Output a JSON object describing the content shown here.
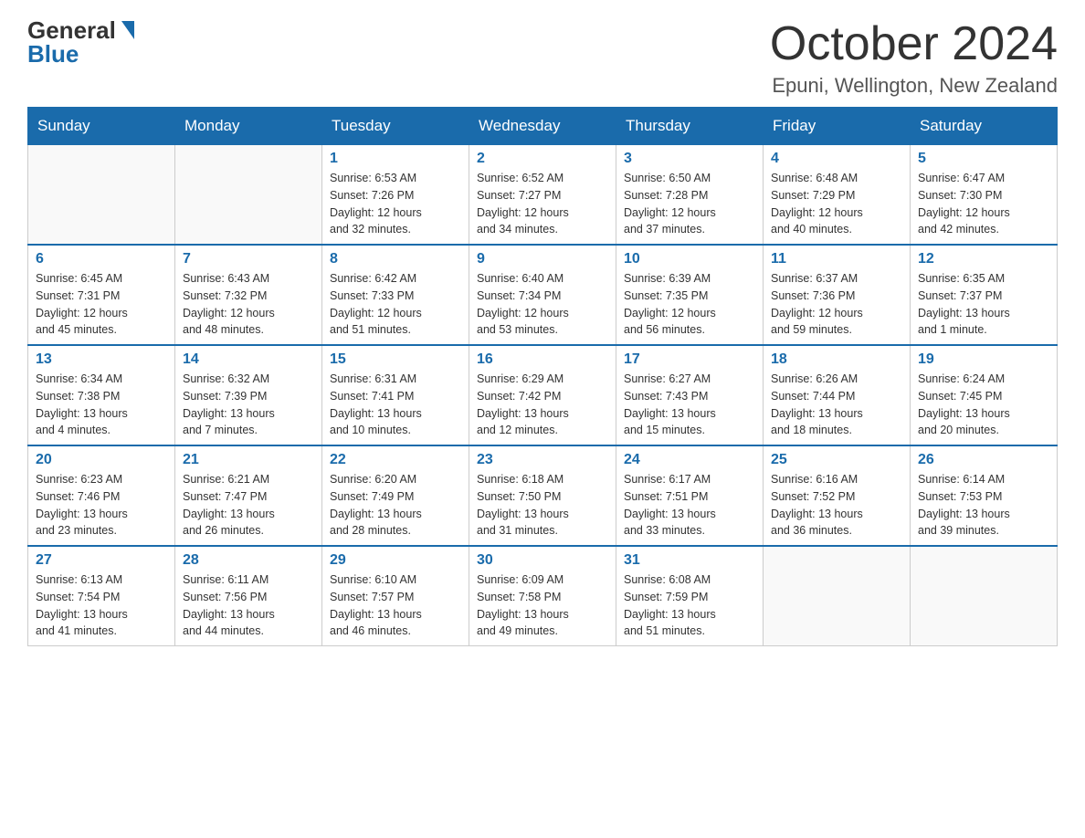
{
  "header": {
    "logo_general": "General",
    "logo_blue": "Blue",
    "month_title": "October 2024",
    "location": "Epuni, Wellington, New Zealand"
  },
  "weekdays": [
    "Sunday",
    "Monday",
    "Tuesday",
    "Wednesday",
    "Thursday",
    "Friday",
    "Saturday"
  ],
  "weeks": [
    [
      {
        "day": "",
        "info": ""
      },
      {
        "day": "",
        "info": ""
      },
      {
        "day": "1",
        "info": "Sunrise: 6:53 AM\nSunset: 7:26 PM\nDaylight: 12 hours\nand 32 minutes."
      },
      {
        "day": "2",
        "info": "Sunrise: 6:52 AM\nSunset: 7:27 PM\nDaylight: 12 hours\nand 34 minutes."
      },
      {
        "day": "3",
        "info": "Sunrise: 6:50 AM\nSunset: 7:28 PM\nDaylight: 12 hours\nand 37 minutes."
      },
      {
        "day": "4",
        "info": "Sunrise: 6:48 AM\nSunset: 7:29 PM\nDaylight: 12 hours\nand 40 minutes."
      },
      {
        "day": "5",
        "info": "Sunrise: 6:47 AM\nSunset: 7:30 PM\nDaylight: 12 hours\nand 42 minutes."
      }
    ],
    [
      {
        "day": "6",
        "info": "Sunrise: 6:45 AM\nSunset: 7:31 PM\nDaylight: 12 hours\nand 45 minutes."
      },
      {
        "day": "7",
        "info": "Sunrise: 6:43 AM\nSunset: 7:32 PM\nDaylight: 12 hours\nand 48 minutes."
      },
      {
        "day": "8",
        "info": "Sunrise: 6:42 AM\nSunset: 7:33 PM\nDaylight: 12 hours\nand 51 minutes."
      },
      {
        "day": "9",
        "info": "Sunrise: 6:40 AM\nSunset: 7:34 PM\nDaylight: 12 hours\nand 53 minutes."
      },
      {
        "day": "10",
        "info": "Sunrise: 6:39 AM\nSunset: 7:35 PM\nDaylight: 12 hours\nand 56 minutes."
      },
      {
        "day": "11",
        "info": "Sunrise: 6:37 AM\nSunset: 7:36 PM\nDaylight: 12 hours\nand 59 minutes."
      },
      {
        "day": "12",
        "info": "Sunrise: 6:35 AM\nSunset: 7:37 PM\nDaylight: 13 hours\nand 1 minute."
      }
    ],
    [
      {
        "day": "13",
        "info": "Sunrise: 6:34 AM\nSunset: 7:38 PM\nDaylight: 13 hours\nand 4 minutes."
      },
      {
        "day": "14",
        "info": "Sunrise: 6:32 AM\nSunset: 7:39 PM\nDaylight: 13 hours\nand 7 minutes."
      },
      {
        "day": "15",
        "info": "Sunrise: 6:31 AM\nSunset: 7:41 PM\nDaylight: 13 hours\nand 10 minutes."
      },
      {
        "day": "16",
        "info": "Sunrise: 6:29 AM\nSunset: 7:42 PM\nDaylight: 13 hours\nand 12 minutes."
      },
      {
        "day": "17",
        "info": "Sunrise: 6:27 AM\nSunset: 7:43 PM\nDaylight: 13 hours\nand 15 minutes."
      },
      {
        "day": "18",
        "info": "Sunrise: 6:26 AM\nSunset: 7:44 PM\nDaylight: 13 hours\nand 18 minutes."
      },
      {
        "day": "19",
        "info": "Sunrise: 6:24 AM\nSunset: 7:45 PM\nDaylight: 13 hours\nand 20 minutes."
      }
    ],
    [
      {
        "day": "20",
        "info": "Sunrise: 6:23 AM\nSunset: 7:46 PM\nDaylight: 13 hours\nand 23 minutes."
      },
      {
        "day": "21",
        "info": "Sunrise: 6:21 AM\nSunset: 7:47 PM\nDaylight: 13 hours\nand 26 minutes."
      },
      {
        "day": "22",
        "info": "Sunrise: 6:20 AM\nSunset: 7:49 PM\nDaylight: 13 hours\nand 28 minutes."
      },
      {
        "day": "23",
        "info": "Sunrise: 6:18 AM\nSunset: 7:50 PM\nDaylight: 13 hours\nand 31 minutes."
      },
      {
        "day": "24",
        "info": "Sunrise: 6:17 AM\nSunset: 7:51 PM\nDaylight: 13 hours\nand 33 minutes."
      },
      {
        "day": "25",
        "info": "Sunrise: 6:16 AM\nSunset: 7:52 PM\nDaylight: 13 hours\nand 36 minutes."
      },
      {
        "day": "26",
        "info": "Sunrise: 6:14 AM\nSunset: 7:53 PM\nDaylight: 13 hours\nand 39 minutes."
      }
    ],
    [
      {
        "day": "27",
        "info": "Sunrise: 6:13 AM\nSunset: 7:54 PM\nDaylight: 13 hours\nand 41 minutes."
      },
      {
        "day": "28",
        "info": "Sunrise: 6:11 AM\nSunset: 7:56 PM\nDaylight: 13 hours\nand 44 minutes."
      },
      {
        "day": "29",
        "info": "Sunrise: 6:10 AM\nSunset: 7:57 PM\nDaylight: 13 hours\nand 46 minutes."
      },
      {
        "day": "30",
        "info": "Sunrise: 6:09 AM\nSunset: 7:58 PM\nDaylight: 13 hours\nand 49 minutes."
      },
      {
        "day": "31",
        "info": "Sunrise: 6:08 AM\nSunset: 7:59 PM\nDaylight: 13 hours\nand 51 minutes."
      },
      {
        "day": "",
        "info": ""
      },
      {
        "day": "",
        "info": ""
      }
    ]
  ]
}
